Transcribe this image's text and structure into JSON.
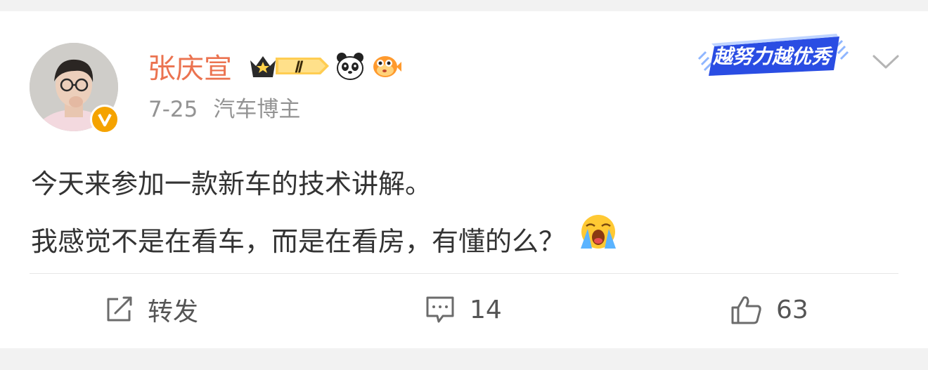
{
  "post": {
    "author": {
      "name": "张庆宣",
      "avatar": "avatar-photo",
      "verified_badge": "verified-v-icon",
      "level_badge": "Ⅱ",
      "badge_icons": [
        "crown-level-badge",
        "panda-icon",
        "pufferfish-icon"
      ]
    },
    "meta": {
      "date": "7-25",
      "tag": "汽车博主"
    },
    "corner_badge": "越努力越优秀",
    "content": {
      "line1": "今天来参加一款新车的技术讲解。",
      "line2": "我感觉不是在看车，而是在看房，有懂的么？",
      "emoji": "crying-emoji"
    },
    "actions": {
      "repost_label": "转发",
      "comment_count": "14",
      "like_count": "63"
    }
  },
  "colors": {
    "name": "#eb7350",
    "meta": "#939393",
    "text": "#333333",
    "action": "#555555",
    "verified": "#f5a300"
  }
}
